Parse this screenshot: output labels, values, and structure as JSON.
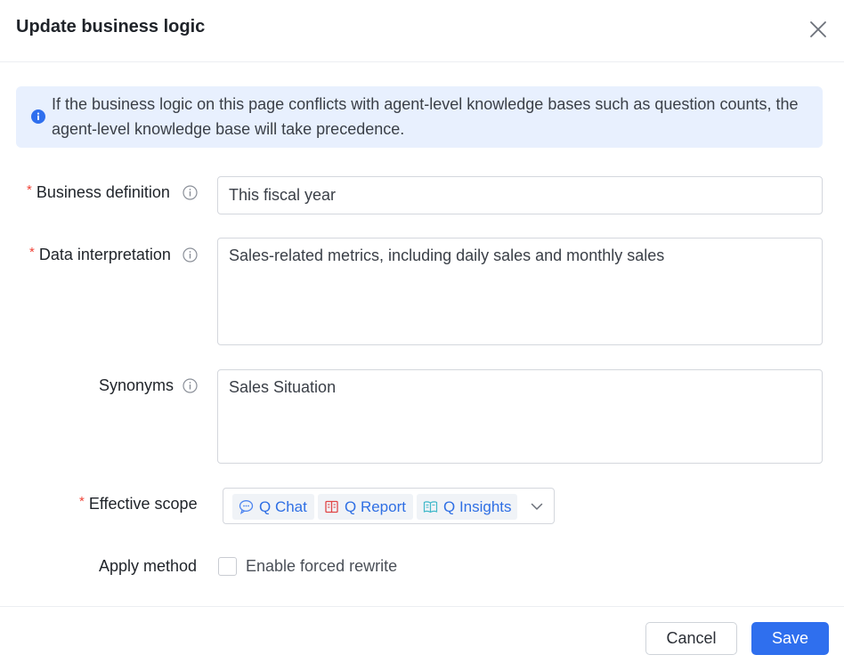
{
  "dialog": {
    "title": "Update business logic",
    "close_icon": "close-icon"
  },
  "notice": {
    "icon": "info-icon",
    "text": "If the business logic on this page conflicts with agent-level knowledge bases such as question counts, the agent-level knowledge base will take precedence."
  },
  "form": {
    "required_mark": "*",
    "business_definition": {
      "label": "Business definition",
      "value": "This fiscal year"
    },
    "data_interpretation": {
      "label": "Data interpretation",
      "value": "Sales-related metrics, including daily sales and monthly sales"
    },
    "synonyms": {
      "label": "Synonyms",
      "value": "Sales Situation"
    },
    "effective_scope": {
      "label": "Effective scope",
      "tags": [
        {
          "label": "Q Chat",
          "icon": "chat-icon"
        },
        {
          "label": "Q Report",
          "icon": "report-icon"
        },
        {
          "label": "Q Insights",
          "icon": "book-icon"
        }
      ]
    },
    "apply_method": {
      "label": "Apply method",
      "checkbox_label": "Enable forced rewrite",
      "checked": false
    }
  },
  "footer": {
    "cancel_label": "Cancel",
    "save_label": "Save"
  },
  "colors": {
    "accent": "#2f6fee",
    "notice_bg": "#e8f0fe",
    "required": "#f04438",
    "tag_text": "#2f6fe4"
  }
}
